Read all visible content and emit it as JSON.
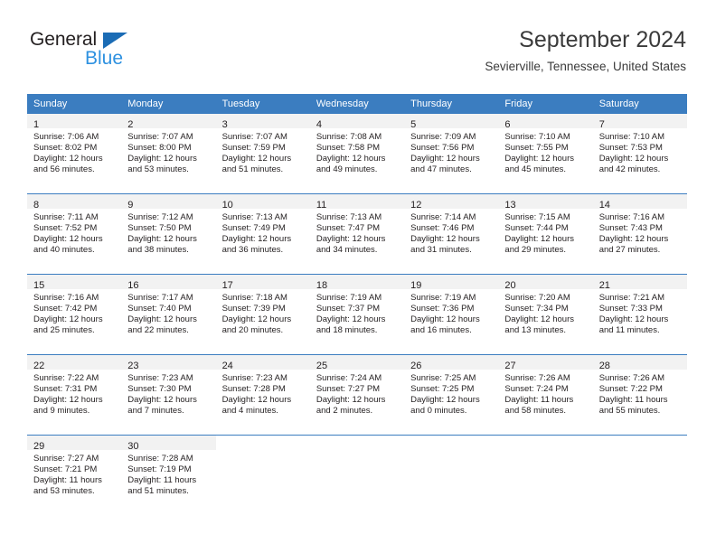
{
  "brand": {
    "word_one": "General",
    "word_two": "Blue",
    "triangle_icon": "triangle-logo-icon",
    "accent_dark": "#1b6cb5",
    "accent_light": "#2e91e0"
  },
  "header": {
    "title": "September 2024",
    "subtitle": "Sevierville, Tennessee, United States"
  },
  "theme": {
    "header_row_bg": "#3b7dc0",
    "daynum_bg": "#f2f2f2",
    "text": "#231f20"
  },
  "weekday_headers": [
    "Sunday",
    "Monday",
    "Tuesday",
    "Wednesday",
    "Thursday",
    "Friday",
    "Saturday"
  ],
  "weeks": [
    [
      {
        "day": "1",
        "sunrise": "Sunrise: 7:06 AM",
        "sunset": "Sunset: 8:02 PM",
        "daylight_1": "Daylight: 12 hours",
        "daylight_2": "and 56 minutes."
      },
      {
        "day": "2",
        "sunrise": "Sunrise: 7:07 AM",
        "sunset": "Sunset: 8:00 PM",
        "daylight_1": "Daylight: 12 hours",
        "daylight_2": "and 53 minutes."
      },
      {
        "day": "3",
        "sunrise": "Sunrise: 7:07 AM",
        "sunset": "Sunset: 7:59 PM",
        "daylight_1": "Daylight: 12 hours",
        "daylight_2": "and 51 minutes."
      },
      {
        "day": "4",
        "sunrise": "Sunrise: 7:08 AM",
        "sunset": "Sunset: 7:58 PM",
        "daylight_1": "Daylight: 12 hours",
        "daylight_2": "and 49 minutes."
      },
      {
        "day": "5",
        "sunrise": "Sunrise: 7:09 AM",
        "sunset": "Sunset: 7:56 PM",
        "daylight_1": "Daylight: 12 hours",
        "daylight_2": "and 47 minutes."
      },
      {
        "day": "6",
        "sunrise": "Sunrise: 7:10 AM",
        "sunset": "Sunset: 7:55 PM",
        "daylight_1": "Daylight: 12 hours",
        "daylight_2": "and 45 minutes."
      },
      {
        "day": "7",
        "sunrise": "Sunrise: 7:10 AM",
        "sunset": "Sunset: 7:53 PM",
        "daylight_1": "Daylight: 12 hours",
        "daylight_2": "and 42 minutes."
      }
    ],
    [
      {
        "day": "8",
        "sunrise": "Sunrise: 7:11 AM",
        "sunset": "Sunset: 7:52 PM",
        "daylight_1": "Daylight: 12 hours",
        "daylight_2": "and 40 minutes."
      },
      {
        "day": "9",
        "sunrise": "Sunrise: 7:12 AM",
        "sunset": "Sunset: 7:50 PM",
        "daylight_1": "Daylight: 12 hours",
        "daylight_2": "and 38 minutes."
      },
      {
        "day": "10",
        "sunrise": "Sunrise: 7:13 AM",
        "sunset": "Sunset: 7:49 PM",
        "daylight_1": "Daylight: 12 hours",
        "daylight_2": "and 36 minutes."
      },
      {
        "day": "11",
        "sunrise": "Sunrise: 7:13 AM",
        "sunset": "Sunset: 7:47 PM",
        "daylight_1": "Daylight: 12 hours",
        "daylight_2": "and 34 minutes."
      },
      {
        "day": "12",
        "sunrise": "Sunrise: 7:14 AM",
        "sunset": "Sunset: 7:46 PM",
        "daylight_1": "Daylight: 12 hours",
        "daylight_2": "and 31 minutes."
      },
      {
        "day": "13",
        "sunrise": "Sunrise: 7:15 AM",
        "sunset": "Sunset: 7:44 PM",
        "daylight_1": "Daylight: 12 hours",
        "daylight_2": "and 29 minutes."
      },
      {
        "day": "14",
        "sunrise": "Sunrise: 7:16 AM",
        "sunset": "Sunset: 7:43 PM",
        "daylight_1": "Daylight: 12 hours",
        "daylight_2": "and 27 minutes."
      }
    ],
    [
      {
        "day": "15",
        "sunrise": "Sunrise: 7:16 AM",
        "sunset": "Sunset: 7:42 PM",
        "daylight_1": "Daylight: 12 hours",
        "daylight_2": "and 25 minutes."
      },
      {
        "day": "16",
        "sunrise": "Sunrise: 7:17 AM",
        "sunset": "Sunset: 7:40 PM",
        "daylight_1": "Daylight: 12 hours",
        "daylight_2": "and 22 minutes."
      },
      {
        "day": "17",
        "sunrise": "Sunrise: 7:18 AM",
        "sunset": "Sunset: 7:39 PM",
        "daylight_1": "Daylight: 12 hours",
        "daylight_2": "and 20 minutes."
      },
      {
        "day": "18",
        "sunrise": "Sunrise: 7:19 AM",
        "sunset": "Sunset: 7:37 PM",
        "daylight_1": "Daylight: 12 hours",
        "daylight_2": "and 18 minutes."
      },
      {
        "day": "19",
        "sunrise": "Sunrise: 7:19 AM",
        "sunset": "Sunset: 7:36 PM",
        "daylight_1": "Daylight: 12 hours",
        "daylight_2": "and 16 minutes."
      },
      {
        "day": "20",
        "sunrise": "Sunrise: 7:20 AM",
        "sunset": "Sunset: 7:34 PM",
        "daylight_1": "Daylight: 12 hours",
        "daylight_2": "and 13 minutes."
      },
      {
        "day": "21",
        "sunrise": "Sunrise: 7:21 AM",
        "sunset": "Sunset: 7:33 PM",
        "daylight_1": "Daylight: 12 hours",
        "daylight_2": "and 11 minutes."
      }
    ],
    [
      {
        "day": "22",
        "sunrise": "Sunrise: 7:22 AM",
        "sunset": "Sunset: 7:31 PM",
        "daylight_1": "Daylight: 12 hours",
        "daylight_2": "and 9 minutes."
      },
      {
        "day": "23",
        "sunrise": "Sunrise: 7:23 AM",
        "sunset": "Sunset: 7:30 PM",
        "daylight_1": "Daylight: 12 hours",
        "daylight_2": "and 7 minutes."
      },
      {
        "day": "24",
        "sunrise": "Sunrise: 7:23 AM",
        "sunset": "Sunset: 7:28 PM",
        "daylight_1": "Daylight: 12 hours",
        "daylight_2": "and 4 minutes."
      },
      {
        "day": "25",
        "sunrise": "Sunrise: 7:24 AM",
        "sunset": "Sunset: 7:27 PM",
        "daylight_1": "Daylight: 12 hours",
        "daylight_2": "and 2 minutes."
      },
      {
        "day": "26",
        "sunrise": "Sunrise: 7:25 AM",
        "sunset": "Sunset: 7:25 PM",
        "daylight_1": "Daylight: 12 hours",
        "daylight_2": "and 0 minutes."
      },
      {
        "day": "27",
        "sunrise": "Sunrise: 7:26 AM",
        "sunset": "Sunset: 7:24 PM",
        "daylight_1": "Daylight: 11 hours",
        "daylight_2": "and 58 minutes."
      },
      {
        "day": "28",
        "sunrise": "Sunrise: 7:26 AM",
        "sunset": "Sunset: 7:22 PM",
        "daylight_1": "Daylight: 11 hours",
        "daylight_2": "and 55 minutes."
      }
    ],
    [
      {
        "day": "29",
        "sunrise": "Sunrise: 7:27 AM",
        "sunset": "Sunset: 7:21 PM",
        "daylight_1": "Daylight: 11 hours",
        "daylight_2": "and 53 minutes."
      },
      {
        "day": "30",
        "sunrise": "Sunrise: 7:28 AM",
        "sunset": "Sunset: 7:19 PM",
        "daylight_1": "Daylight: 11 hours",
        "daylight_2": "and 51 minutes."
      },
      {
        "day": "",
        "sunrise": "",
        "sunset": "",
        "daylight_1": "",
        "daylight_2": ""
      },
      {
        "day": "",
        "sunrise": "",
        "sunset": "",
        "daylight_1": "",
        "daylight_2": ""
      },
      {
        "day": "",
        "sunrise": "",
        "sunset": "",
        "daylight_1": "",
        "daylight_2": ""
      },
      {
        "day": "",
        "sunrise": "",
        "sunset": "",
        "daylight_1": "",
        "daylight_2": ""
      },
      {
        "day": "",
        "sunrise": "",
        "sunset": "",
        "daylight_1": "",
        "daylight_2": ""
      }
    ]
  ]
}
